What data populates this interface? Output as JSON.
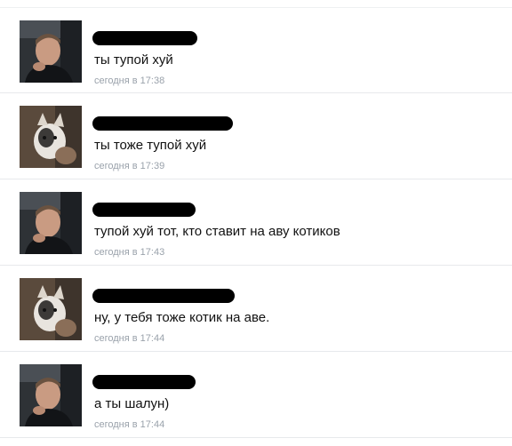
{
  "comments": [
    {
      "avatar": "man-in-car-photo",
      "text": "ты тупой хуй",
      "time": "сегодня в 17:38"
    },
    {
      "avatar": "cat-photo",
      "text": "ты тоже тупой хуй",
      "time": "сегодня в 17:39"
    },
    {
      "avatar": "man-in-car-photo",
      "text": "тупой хуй тот, кто ставит на аву котиков",
      "time": "сегодня в 17:43"
    },
    {
      "avatar": "cat-photo",
      "text": "ну, у тебя тоже котик на аве.",
      "time": "сегодня в 17:44"
    },
    {
      "avatar": "man-in-car-photo",
      "text": "а ты шалун)",
      "time": "сегодня в 17:44"
    }
  ]
}
